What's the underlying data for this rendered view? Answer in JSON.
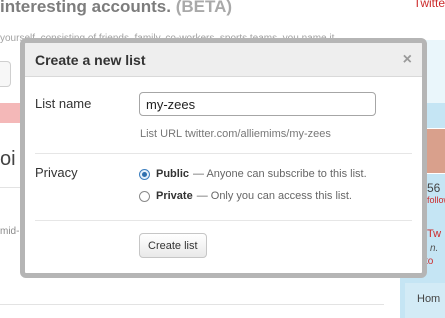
{
  "background": {
    "title_text": "interesting accounts.",
    "title_badge": "(BETA)",
    "corner_text": "Twitte",
    "subtext": "yourself, consisting of friends, family, co-workers, sports teams, you name it.",
    "left_heading": "oi",
    "mid_text": "mid-",
    "right_number": "56",
    "right_follow": "follow",
    "right_tw": "Tw",
    "right_line2": "n.",
    "right_line3": "to",
    "right_home": "Hom"
  },
  "modal": {
    "title": "Create a new list",
    "close_symbol": "×",
    "list_name": {
      "label": "List name",
      "value": "my-zees",
      "url_hint": "List URL twitter.com/alliemims/my-zees"
    },
    "privacy": {
      "label": "Privacy",
      "options": [
        {
          "name": "Public",
          "description": "— Anyone can subscribe to this list.",
          "selected": true
        },
        {
          "name": "Private",
          "description": "— Only you can access this list.",
          "selected": false
        }
      ]
    },
    "submit_label": "Create list"
  }
}
